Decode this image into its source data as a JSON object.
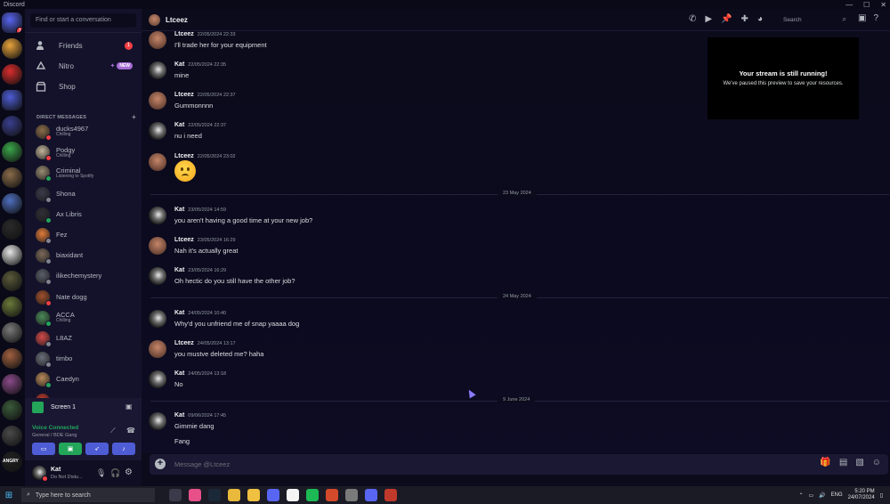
{
  "window": {
    "title": "Discord",
    "minimize": "—",
    "maximize": "☐",
    "close": "✕"
  },
  "sidebar": {
    "search_placeholder": "Find or start a conversation",
    "nav": [
      {
        "label": "Friends",
        "badge": "1"
      },
      {
        "label": "Nitro",
        "badge": "NEW"
      },
      {
        "label": "Shop"
      }
    ],
    "dm_header": "DIRECT MESSAGES",
    "dm_add": "+",
    "dms": [
      {
        "name": "ducks4967",
        "sub": "Chilling",
        "color": "#8b6d4a",
        "status": "#f23f43"
      },
      {
        "name": "Podgy",
        "sub": "Chilling",
        "color": "#c2b59a",
        "status": "#f23f43"
      },
      {
        "name": "Criminal",
        "sub": "Listening to Spotify",
        "color": "#9a8b72",
        "status": "#23a55a"
      },
      {
        "name": "Shona",
        "sub": "",
        "color": "#3b3a4a",
        "status": "#80848e"
      },
      {
        "name": "Ax Libris",
        "sub": "",
        "color": "#2f2f36",
        "status": "#23a55a"
      },
      {
        "name": "Fez",
        "sub": "",
        "color": "#e07b3a",
        "status": "#80848e"
      },
      {
        "name": "biaxidant",
        "sub": "",
        "color": "#7c6a5a",
        "status": "#80848e"
      },
      {
        "name": "ilikechemystery",
        "sub": "",
        "color": "#5a5f6a",
        "status": "#80848e"
      },
      {
        "name": "Nate dogg",
        "sub": "",
        "color": "#a1502c",
        "status": "#f23f43"
      },
      {
        "name": "ACCA",
        "sub": "Chilling",
        "color": "#4a8a5a",
        "status": "#23a55a"
      },
      {
        "name": "L8AZ",
        "sub": "",
        "color": "#d34a4a",
        "status": "#80848e"
      },
      {
        "name": "timbo",
        "sub": "",
        "color": "#6a6f7a",
        "status": "#80848e"
      },
      {
        "name": "Caedyn",
        "sub": "",
        "color": "#b88a5a",
        "status": "#23a55a"
      },
      {
        "name": "Rogua",
        "sub": "",
        "color": "#c0392b",
        "status": "#80848e"
      }
    ]
  },
  "voice": {
    "screen_label": "Screen 1",
    "connected": "Voice Connected",
    "channel": "General / BDE Gang",
    "user_name": "Kat",
    "user_status": "Do Not Distu..."
  },
  "servers": [
    {
      "color": "#5865f2",
      "badge": "1"
    },
    {
      "color": "#e8a33c"
    },
    {
      "color": "#d92d2d"
    },
    {
      "color": "#4e5dd6"
    },
    {
      "color": "#3a3f8f"
    },
    {
      "color": "#3aa64a"
    },
    {
      "color": "#8a6b4a"
    },
    {
      "color": "#4f6fbf"
    },
    {
      "color": "#2a2a2a"
    },
    {
      "color": "#e6e6e6"
    },
    {
      "color": "#5a5a3a"
    },
    {
      "color": "#6a7a3a"
    },
    {
      "color": "#7a7a7a"
    },
    {
      "color": "#a06040"
    },
    {
      "color": "#8a4a8a"
    },
    {
      "color": "#3a5a3a"
    },
    {
      "color": "#4a4a4a"
    },
    {
      "color": "#222222",
      "label": "ANGRY"
    }
  ],
  "header": {
    "title": "Ltceez",
    "search_placeholder": "Search"
  },
  "stream_overlay": {
    "title": "Your stream is still running!",
    "subtitle": "We've paused this preview to save your resources."
  },
  "messages": [
    {
      "author": "Ltceez",
      "time": "22/05/2024 22:33",
      "text": "I'll trade her for your equipment",
      "who": "lt"
    },
    {
      "author": "Kat",
      "time": "22/05/2024 22:35",
      "text": "mine",
      "who": "kat"
    },
    {
      "author": "Ltceez",
      "time": "22/05/2024 22:37",
      "text": "Gummonnnn",
      "who": "lt"
    },
    {
      "author": "Kat",
      "time": "22/05/2024 22:37",
      "text": "nu i need",
      "who": "kat"
    },
    {
      "author": "Ltceez",
      "time": "22/05/2024 23:02",
      "text": "",
      "who": "lt",
      "emoji": "frowning"
    },
    {
      "author": "Kat",
      "time": "23/05/2024 14:59",
      "text": "you aren't having a good time at your new job?",
      "who": "kat"
    },
    {
      "author": "Ltceez",
      "time": "23/05/2024 16:29",
      "text": "Nah it's actually great",
      "who": "lt"
    },
    {
      "author": "Kat",
      "time": "23/05/2024 16:29",
      "text": "Oh hectic do you still have the other job?",
      "who": "kat"
    },
    {
      "author": "Kat",
      "time": "24/05/2024 10:40",
      "text": "Why'd you unfriend me of snap yaaaa dog",
      "who": "kat"
    },
    {
      "author": "Ltceez",
      "time": "24/05/2024 13:17",
      "text": "you mustve deleted me? haha",
      "who": "lt"
    },
    {
      "author": "Kat",
      "time": "24/05/2024 13:18",
      "text": "No",
      "who": "kat"
    },
    {
      "author": "Kat",
      "time": "09/06/2024 17:45",
      "text": "Gimmie dang",
      "text2": "Fang",
      "who": "kat"
    }
  ],
  "date_separators": [
    "23 May 2024",
    "24 May 2024",
    "9 June 2024"
  ],
  "composer": {
    "placeholder": "Message @Ltceez"
  },
  "taskbar": {
    "search_placeholder": "Type here to search",
    "lang": "ENG",
    "time": "5:20 PM",
    "date": "24/07/2024"
  }
}
